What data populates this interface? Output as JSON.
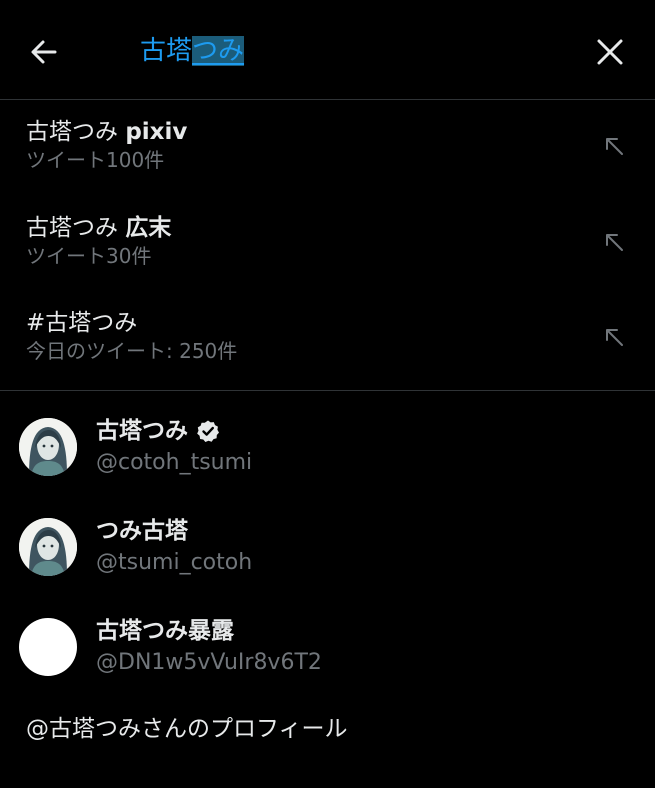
{
  "header": {
    "query_prefix": "古塔",
    "query_composing": "つみ",
    "back_icon": "arrow-left-icon",
    "close_icon": "close-icon"
  },
  "suggestions": [
    {
      "title_plain": "古塔つみ ",
      "title_bold": "pixiv",
      "subtitle": "ツイート100件"
    },
    {
      "title_plain": "古塔つみ ",
      "title_bold": "広末",
      "subtitle": "ツイート30件"
    },
    {
      "title_plain": "#古塔つみ",
      "title_bold": "",
      "subtitle": "今日のツイート: 250件"
    }
  ],
  "users": [
    {
      "name": "古塔つみ",
      "handle": "@cotoh_tsumi",
      "verified": true,
      "avatar": "illustrated-portrait"
    },
    {
      "name": "つみ古塔",
      "handle": "@tsumi_cotoh",
      "verified": false,
      "avatar": "illustrated-portrait"
    },
    {
      "name": "古塔つみ暴露",
      "handle": "@DN1w5vVuIr8v6T2",
      "verified": false,
      "avatar": "blank-white"
    }
  ],
  "profile_link": "@古塔つみさんのプロフィール",
  "colors": {
    "accent": "#1d9bf0",
    "background": "#000000",
    "text": "#e7e9ea",
    "secondary_text": "#71767b",
    "divider": "#2f3336"
  }
}
